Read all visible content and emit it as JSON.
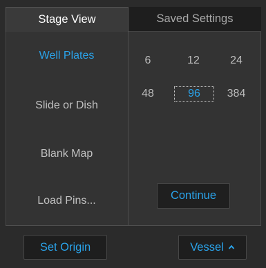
{
  "tabs": [
    {
      "label": "Stage View"
    },
    {
      "label": "Saved Settings"
    }
  ],
  "vessel_types": [
    {
      "label": "Well Plates",
      "selected": true
    },
    {
      "label": "Slide or Dish",
      "selected": false
    },
    {
      "label": "Blank Map",
      "selected": false
    },
    {
      "label": "Load Pins...",
      "selected": false
    }
  ],
  "well_counts": [
    "6",
    "12",
    "24",
    "48",
    "96",
    "384"
  ],
  "selected_well_count": "96",
  "continue_label": "Continue",
  "footer": {
    "set_origin_label": "Set Origin",
    "vessel_label": "Vessel",
    "vessel_icon": "chevron-up-icon"
  },
  "colors": {
    "accent": "#2aa3ea",
    "text": "#c2c2c2",
    "panel": "#333333"
  }
}
